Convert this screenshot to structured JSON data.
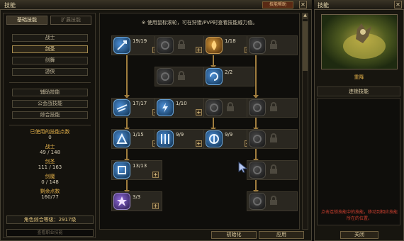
{
  "window": {
    "title": "技能",
    "help_label": "技能帮助",
    "close_glyph": "✕"
  },
  "tabs": {
    "basic": "基础技能",
    "ext": "扩展技能"
  },
  "class_tree": {
    "items": [
      "战士",
      "剑圣",
      "剑舞",
      "游侠"
    ],
    "selected": "剑圣"
  },
  "filters": [
    "辅助技能",
    "公会战技能",
    "综合技能"
  ],
  "stats": {
    "used_points_label": "已使用的技能点数",
    "used_points_value": "0",
    "class1_label": "战士",
    "class1_value": "49 / 148",
    "class2_label": "剑圣",
    "class2_value": "111 / 163",
    "class3_label": "剑魔",
    "class3_value": "0 / 148",
    "remaining_label": "剩余点数",
    "remaining_value": "160/77"
  },
  "level_text": "角色综合等级：2917级",
  "search_placeholder": "查看职业技能",
  "tree": {
    "notice": "※ 使用鼠标滚轮，可在狩猎/PVP时查看技能威力值。",
    "slots": [
      {
        "level": "19/19",
        "icon": "sword-slash-icon",
        "color": "blue",
        "plus": true
      },
      {
        "level": "",
        "icon": "locked-skill-icon",
        "color": "dim",
        "plus": true
      },
      {
        "level": "1/18",
        "icon": "fire-burst-icon",
        "color": "gold",
        "plus": true
      },
      {
        "level": "",
        "icon": "locked-skill-icon",
        "color": "dim",
        "plus": false
      },
      {
        "level": "",
        "icon": "locked-skill-icon",
        "color": "dim",
        "plus": false
      },
      {
        "level": "2/2",
        "icon": "whirlwind-icon",
        "color": "blue",
        "plus": false
      },
      {
        "level": "17/17",
        "icon": "dash-icon",
        "color": "blue",
        "plus": true
      },
      {
        "level": "1/10",
        "icon": "lightning-icon",
        "color": "blue",
        "plus": true
      },
      {
        "level": "",
        "icon": "locked-skill-icon",
        "color": "dim",
        "plus": false
      },
      {
        "level": "",
        "icon": "locked-skill-icon",
        "color": "dim",
        "plus": false
      },
      {
        "level": "1/15",
        "icon": "charge-icon",
        "color": "blue",
        "plus": true
      },
      {
        "level": "9/9",
        "icon": "blade-rain-icon",
        "color": "blue",
        "plus": true
      },
      {
        "level": "9/9",
        "icon": "spin-strike-icon",
        "color": "blue",
        "plus": true
      },
      {
        "level": "",
        "icon": "locked-skill-icon",
        "color": "dim",
        "plus": false
      },
      {
        "level": "13/13",
        "icon": "stance-icon",
        "color": "blue",
        "plus": true
      },
      {
        "level": "",
        "icon": "locked-skill-icon",
        "color": "dim",
        "plus": false
      },
      {
        "level": "3/3",
        "icon": "star-blessing-icon",
        "color": "purple",
        "plus": true
      },
      {
        "level": "",
        "icon": "locked-skill-icon",
        "color": "dim",
        "plus": false
      }
    ]
  },
  "buttons": {
    "reset": "初始化",
    "apply": "应用"
  },
  "right": {
    "title": "技能",
    "preview_name": "重降",
    "combo_header": "连锁技能",
    "hint": "点击连锁技能中的技能，移动到相应技能所在的位置。",
    "close_label": "关闭"
  },
  "colors": {
    "accent_gold": "#e4b14a",
    "warning_red": "#d04030"
  }
}
